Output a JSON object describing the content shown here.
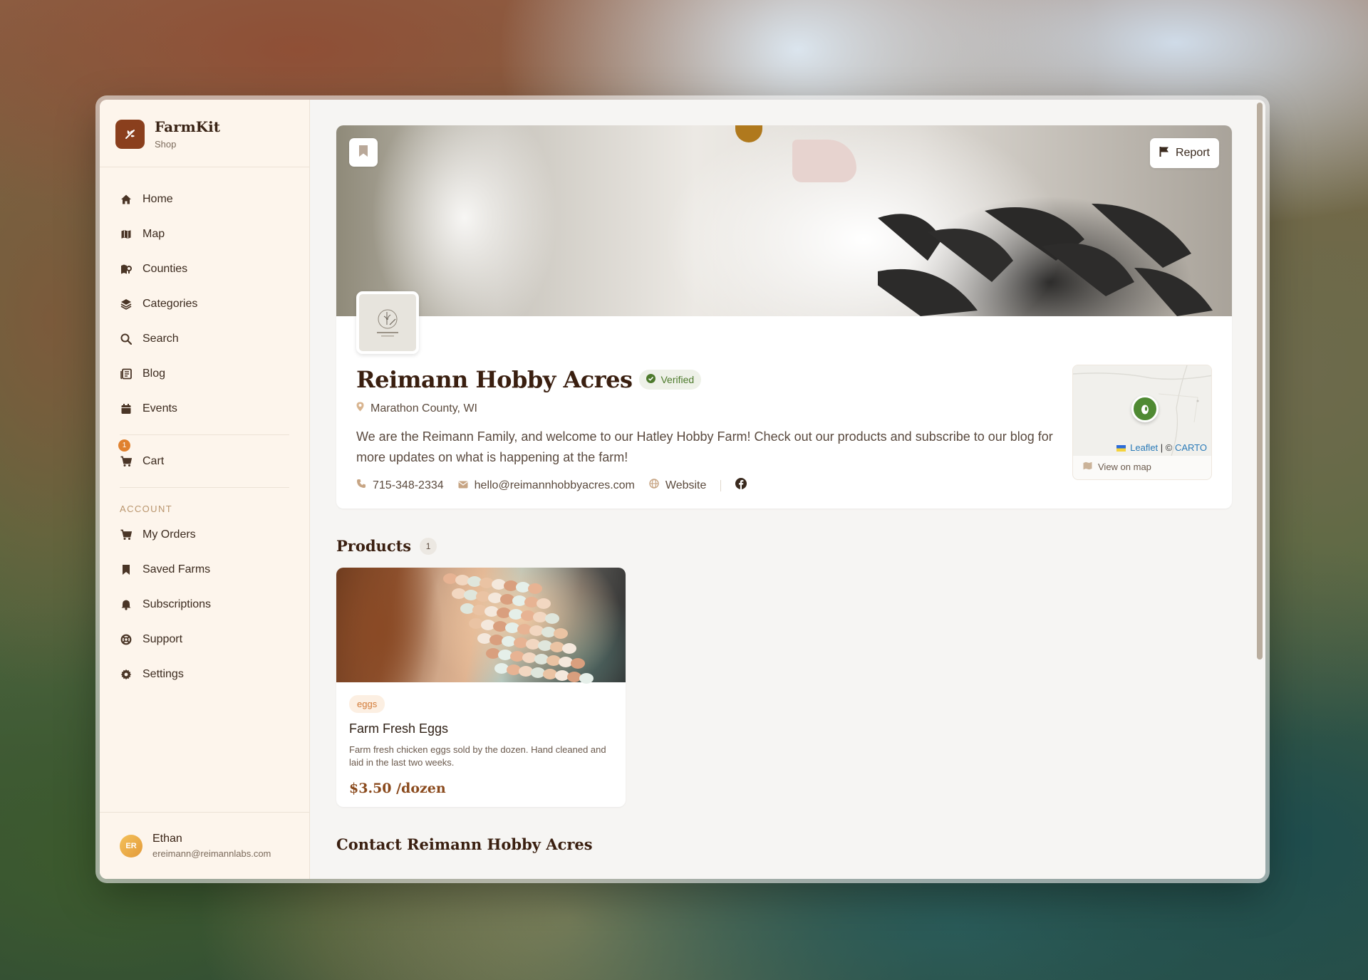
{
  "brand": {
    "name": "FarmKit",
    "subtitle": "Shop"
  },
  "nav": [
    {
      "label": "Home",
      "icon": "home-icon"
    },
    {
      "label": "Map",
      "icon": "map-icon"
    },
    {
      "label": "Counties",
      "icon": "counties-icon"
    },
    {
      "label": "Categories",
      "icon": "layers-icon"
    },
    {
      "label": "Search",
      "icon": "search-icon"
    },
    {
      "label": "Blog",
      "icon": "blog-icon"
    },
    {
      "label": "Events",
      "icon": "calendar-icon"
    }
  ],
  "cart": {
    "label": "Cart",
    "count": "1"
  },
  "account": {
    "section_label": "ACCOUNT",
    "items": [
      {
        "label": "My Orders",
        "icon": "cart-icon"
      },
      {
        "label": "Saved Farms",
        "icon": "bookmark-icon"
      },
      {
        "label": "Subscriptions",
        "icon": "bell-icon"
      },
      {
        "label": "Support",
        "icon": "lifebuoy-icon"
      },
      {
        "label": "Settings",
        "icon": "gear-icon"
      }
    ]
  },
  "user": {
    "initials": "ER",
    "name": "Ethan",
    "email": "ereimann@reimannlabs.com"
  },
  "farm": {
    "report_label": "Report",
    "name": "Reimann Hobby Acres",
    "verified_label": "Verified",
    "location": "Marathon County, WI",
    "description": "We are the Reimann Family, and welcome to our Hatley Hobby Farm! Check out our products and subscribe to our blog for more updates on what is happening at the farm!",
    "phone": "715-348-2334",
    "email": "hello@reimannhobbyacres.com",
    "website_label": "Website",
    "map": {
      "attribution_leaflet": "Leaflet",
      "attribution_sep": " | © ",
      "attribution_carto": "CARTO",
      "view_label": "View on map"
    }
  },
  "products": {
    "title": "Products",
    "count": "1",
    "items": [
      {
        "tag": "eggs",
        "name": "Farm Fresh Eggs",
        "description": "Farm fresh chicken eggs sold by the dozen. Hand cleaned and laid in the last two weeks.",
        "price": "$3.50 /dozen"
      }
    ]
  },
  "contact_title": "Contact Reimann Hobby Acres",
  "colors": {
    "brand": "#8a3f1d",
    "accent": "#e0812f",
    "verified": "#4d7a2c",
    "price": "#8a4a1d"
  }
}
